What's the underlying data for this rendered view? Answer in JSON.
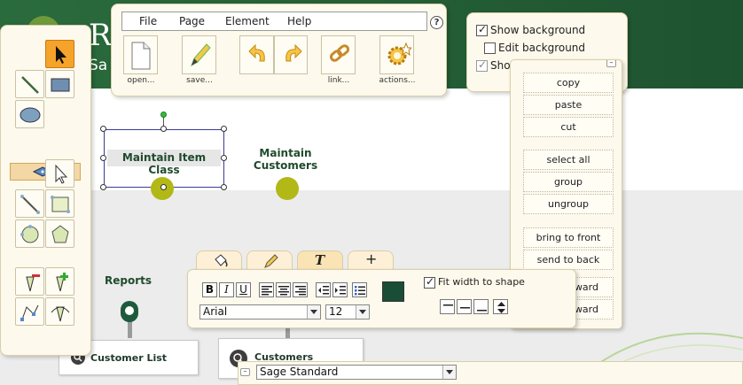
{
  "canvas": {
    "banner_letter": "R",
    "banner_sub": "Sa",
    "shapes": {
      "maintain_item_class": "Maintain Item Class",
      "maintain_customers": "Maintain\nCustomers",
      "reports": "Reports",
      "customer_list": "Customer List",
      "customers": "Customers"
    }
  },
  "main_panel": {
    "menu": [
      "File",
      "Page",
      "Element",
      "Help"
    ],
    "help_label": "?",
    "toolbar": {
      "open_label": "open...",
      "save_label": "save...",
      "undo_icon": "undo-icon",
      "redo_icon": "redo-icon",
      "link_label": "link...",
      "actions_label": "actions..."
    }
  },
  "background_panel": {
    "show_background": "Show background",
    "edit_background": "Edit background",
    "show_third": "Sho"
  },
  "context_menu": {
    "items": [
      "copy",
      "paste",
      "cut",
      "select all",
      "group",
      "ungroup",
      "bring to front",
      "send to back",
      "ward",
      "ward"
    ]
  },
  "format_panel": {
    "tabs": [
      "paint-bucket-icon",
      "pencil-icon",
      "T",
      "+"
    ],
    "bold": "B",
    "italic": "I",
    "underline": "U",
    "font_family": "Arial",
    "font_size": "12",
    "fit_width_label": "Fit width to shape",
    "text_color": "#1a4d35"
  },
  "style_bar": {
    "minimize": "–",
    "value": "Sage Standard"
  },
  "colors": {
    "banner": "#1e5330",
    "panel": "#fdf9ec",
    "active_tool": "#f5a32a",
    "accent_dot": "#b2b815"
  }
}
